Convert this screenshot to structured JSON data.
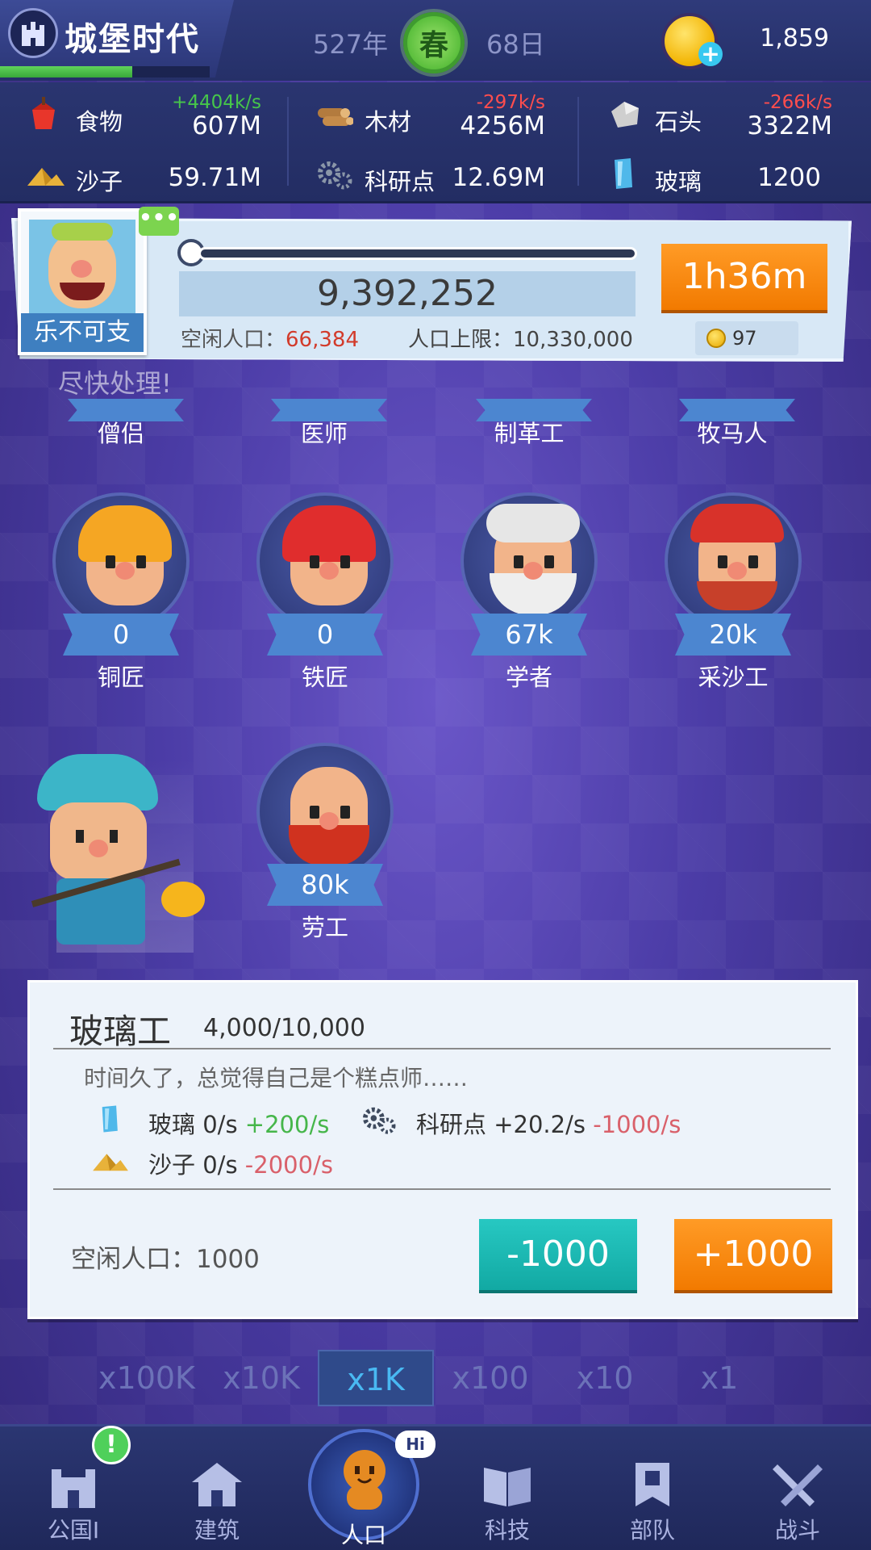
{
  "app": {
    "title": "城堡时代"
  },
  "calendar": {
    "year": "527年",
    "season": "春",
    "day": "68日"
  },
  "coins": {
    "value": "1,859"
  },
  "resources": [
    {
      "name": "食物",
      "rate": "+4404k/s",
      "value": "607M",
      "icon": "food-icon"
    },
    {
      "name": "木材",
      "rate": "-297k/s",
      "value": "4256M",
      "icon": "wood-icon"
    },
    {
      "name": "石头",
      "rate": "-266k/s",
      "value": "3322M",
      "icon": "stone-icon"
    },
    {
      "name": "沙子",
      "rate": "",
      "value": "59.71M",
      "icon": "sand-icon"
    },
    {
      "name": "科研点",
      "rate": "",
      "value": "12.69M",
      "icon": "research-icon"
    },
    {
      "name": "玻璃",
      "rate": "",
      "value": "1200",
      "icon": "glass-icon"
    }
  ],
  "colors": {
    "positive": "#46b64a",
    "negative": "#e04848",
    "accent_orange": "#f27a00",
    "accent_teal": "#12a9a3"
  },
  "manager": {
    "name": "乐不可支",
    "population": "9,392,252",
    "idle_label": "空闲人口：",
    "idle_value": "66,384",
    "cap_label": "人口上限：",
    "cap_value": "10,330,000",
    "timer": "1h36m",
    "cost": "97",
    "hurry_text": "尽快处理!",
    "chat": "•••"
  },
  "workers_partial": [
    {
      "name": "僧侣"
    },
    {
      "name": "医师"
    },
    {
      "name": "制革工"
    },
    {
      "name": "牧马人"
    }
  ],
  "workers": [
    {
      "name": "铜匠",
      "count": "0"
    },
    {
      "name": "铁匠",
      "count": "0"
    },
    {
      "name": "学者",
      "count": "67k"
    },
    {
      "name": "采沙工",
      "count": "20k"
    },
    {
      "name": "劳工",
      "count": "80k"
    }
  ],
  "selected": {
    "title": "玻璃工",
    "count": "4,000/10,000",
    "desc": "时间久了，总觉得自己是个糕点师……",
    "effects": [
      {
        "name": "玻璃",
        "base": "0/s",
        "delta": "+200/s",
        "icon": "glass-icon"
      },
      {
        "name": "科研点",
        "base": "+20.2/s",
        "delta": "-1000/s",
        "icon": "research-icon"
      },
      {
        "name": "沙子",
        "base": "0/s",
        "delta": "-2000/s",
        "icon": "sand-icon"
      }
    ],
    "idle": "空闲人口：1000",
    "minus": "-1000",
    "plus": "+1000"
  },
  "multipliers": [
    "x100K",
    "x10K",
    "x1K",
    "x100",
    "x10",
    "x1"
  ],
  "multiplier_selected": "x1K",
  "nav": [
    {
      "label": "公国I",
      "icon": "castle-icon"
    },
    {
      "label": "建筑",
      "icon": "house-icon"
    },
    {
      "label": "人口",
      "icon": "citizen-icon"
    },
    {
      "label": "科技",
      "icon": "book-icon"
    },
    {
      "label": "部队",
      "icon": "banner-icon"
    },
    {
      "label": "战斗",
      "icon": "crossed-swords-icon"
    }
  ],
  "nav_badges": {
    "alert": "!",
    "hi": "Hi"
  }
}
